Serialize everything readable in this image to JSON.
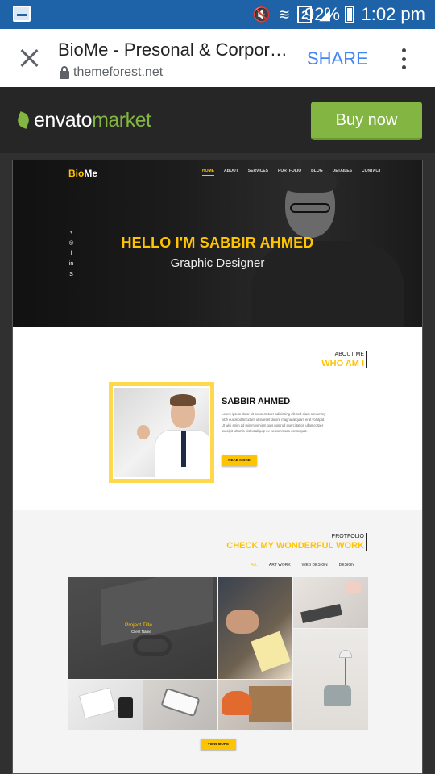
{
  "status_bar": {
    "battery_pct": "92%",
    "time": "1:02 pm",
    "sim_slot": "2"
  },
  "browser": {
    "page_title": "BioMe - Presonal & Corporate Agency Template",
    "url": "themeforest.net",
    "share_label": "SHARE"
  },
  "envato": {
    "brand": "envato",
    "brand_suffix": "market",
    "buy_label": "Buy now",
    "accent": "#82b541"
  },
  "preview": {
    "accent": "#ffc400",
    "logo_prefix": "Bio",
    "logo_suffix": "Me",
    "nav": [
      "HOME",
      "ABOUT",
      "SERVICES",
      "PORTFOLIO",
      "BLOG",
      "DETAILES",
      "CONTACT"
    ],
    "social_icons": [
      "twitter-icon",
      "dribbble-icon",
      "facebook-icon",
      "linkedin-icon",
      "skype-icon"
    ],
    "hero_title": "HELLO I'M SABBIR AHMED",
    "hero_subtitle": "Graphic Designer",
    "about": {
      "eyebrow": "ABOUT ME",
      "heading": "WHO AM I",
      "name": "SABBIR AHMED",
      "bio": "Lorem ipsum dolor sit consectetuer adipiscing elit sed diam nonummy nibh euismod tincidunt ut laoreet dolore magna aliquam erat volutpat. Ut wisi enim ad minim veniam quis nostrud exerci tation ullamcorper suscipit lobortis nisl ut aliquip ex ea commodo consequat.",
      "read_more": "READ MORE"
    },
    "portfolio": {
      "eyebrow": "PROTFOLIO",
      "heading": "CHECK MY WONDERFUL WORK",
      "filters": [
        "ALL",
        "ART WORK",
        "WEB DESIGN",
        "DESIGN"
      ],
      "project_title": "Project Title",
      "client_name": "Client Name",
      "view_more": "VIEW MORE"
    }
  }
}
